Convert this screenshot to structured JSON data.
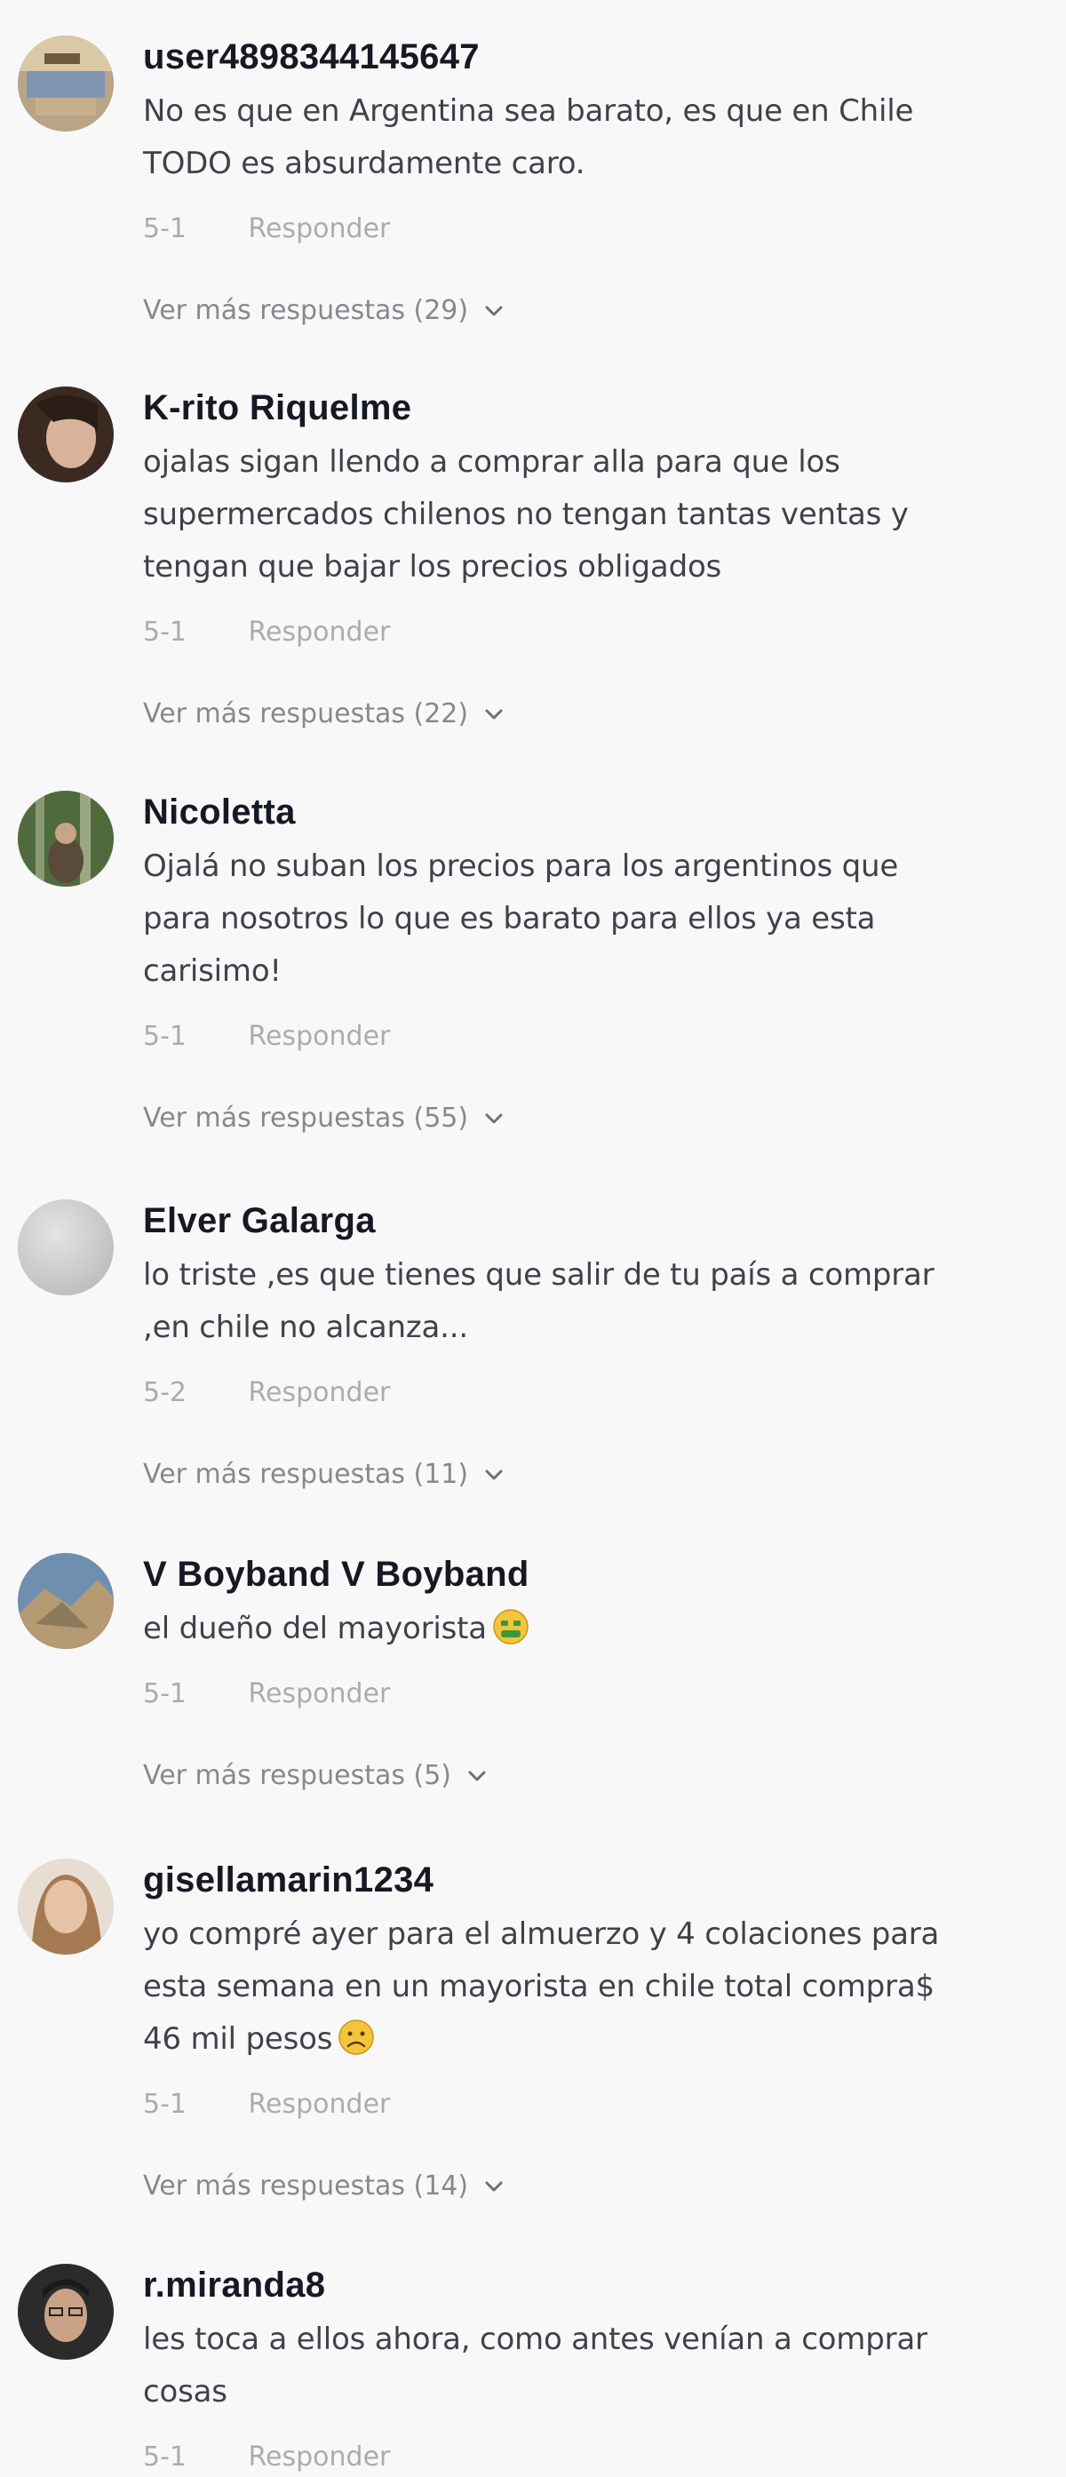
{
  "comments": [
    {
      "username": "user4898344145647",
      "text": "No es que en Argentina sea barato, es que en Chile\nTODO es absurdamente caro.",
      "date": "5-1",
      "reply_label": "Responder",
      "more_label": "Ver más respuestas (29)"
    },
    {
      "username": "K-rito Riquelme",
      "text": "ojalas sigan llendo a comprar alla para que los\nsupermercados chilenos no tengan tantas ventas y\ntengan que bajar los precios obligados",
      "date": "5-1",
      "reply_label": "Responder",
      "more_label": "Ver más respuestas (22)"
    },
    {
      "username": "Nicoletta",
      "text": "Ojalá no suban los precios para los argentinos que\npara nosotros lo que es barato para ellos ya esta\ncarisimo!",
      "date": "5-1",
      "reply_label": "Responder",
      "more_label": "Ver más respuestas (55)"
    },
    {
      "username": "Elver Galarga",
      "text": "lo triste ,es que tienes que salir de tu país a comprar\n,en chile no alcanza...",
      "date": "5-2",
      "reply_label": "Responder",
      "more_label": "Ver más respuestas (11)"
    },
    {
      "username": "V Boyband V Boyband",
      "text": "el dueño del mayorista",
      "emoji": "money-mouth-face",
      "date": "5-1",
      "reply_label": "Responder",
      "more_label": "Ver más respuestas (5)"
    },
    {
      "username": "gisellamarin1234",
      "text": "yo compré ayer para el almuerzo y 4 colaciones para\nesta semana en un mayorista en chile total compra$\n46 mil pesos",
      "emoji": "frowning-face",
      "date": "5-1",
      "reply_label": "Responder",
      "more_label": "Ver más respuestas (14)"
    },
    {
      "username": "r.miranda8",
      "text": "les toca a ellos ahora, como antes venían a comprar\ncosas",
      "date": "5-1",
      "reply_label": "Responder"
    }
  ],
  "colors": {
    "background": "#f8f8f8",
    "username": "#161823",
    "meta": "#a7a8ac"
  }
}
